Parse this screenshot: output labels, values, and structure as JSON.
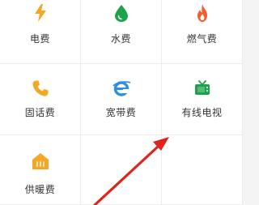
{
  "colors": {
    "electric": "#f5a623",
    "water": "#1aa34a",
    "gas": "#f35c2e",
    "landline": "#f5a623",
    "broadband": "#2f8fe0",
    "cable_tv": "#1aa34a",
    "heating": "#f5a623",
    "arrow": "#e0241c"
  },
  "items": [
    {
      "label": "电费",
      "icon": "lightning-icon"
    },
    {
      "label": "水费",
      "icon": "water-drop-icon"
    },
    {
      "label": "燃气费",
      "icon": "flame-icon"
    },
    {
      "label": "固话费",
      "icon": "phone-icon"
    },
    {
      "label": "宽带费",
      "icon": "broadband-icon"
    },
    {
      "label": "有线电视",
      "icon": "tv-icon"
    },
    {
      "label": "供暖费",
      "icon": "heating-icon"
    }
  ]
}
